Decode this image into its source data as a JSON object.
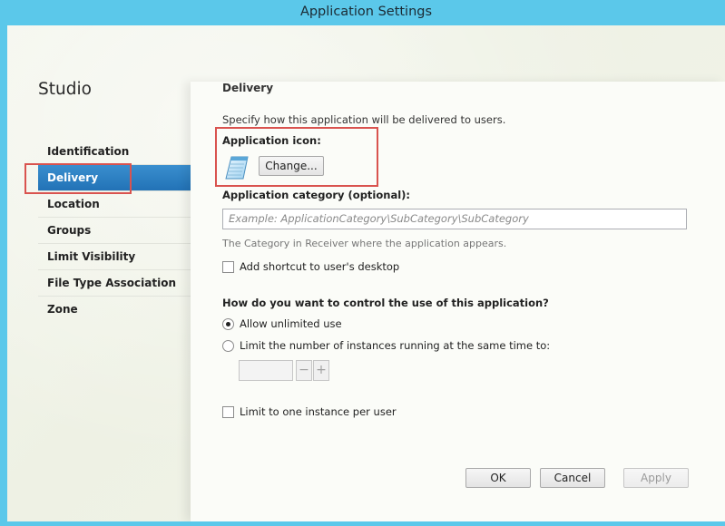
{
  "window": {
    "title": "Application Settings"
  },
  "sidebar": {
    "title": "Studio",
    "items": [
      {
        "label": "Identification",
        "active": false
      },
      {
        "label": "Delivery",
        "active": true
      },
      {
        "label": "Location",
        "active": false
      },
      {
        "label": "Groups",
        "active": false
      },
      {
        "label": "Limit Visibility",
        "active": false
      },
      {
        "label": "File Type Association",
        "active": false
      },
      {
        "label": "Zone",
        "active": false
      }
    ]
  },
  "main": {
    "heading": "Delivery",
    "description": "Specify how this application will be delivered to users.",
    "app_icon_label": "Application icon:",
    "change_button": "Change...",
    "category_label": "Application category (optional):",
    "category_placeholder": "Example: ApplicationCategory\\SubCategory\\SubCategory",
    "category_hint": "The Category in Receiver where the application appears.",
    "shortcut_label": "Add shortcut to user's desktop",
    "shortcut_checked": false,
    "usage_question": "How do you want to control the use of this application?",
    "allow_unlimited_label": "Allow unlimited use",
    "limit_instances_label": "Limit the number of instances running at the same time to:",
    "selected_option": "allow_unlimited",
    "instances_value": "",
    "stepper_minus": "−",
    "stepper_plus": "+",
    "one_instance_label": "Limit to one instance per user",
    "one_instance_checked": false
  },
  "footer": {
    "ok_label": "OK",
    "cancel_label": "Cancel",
    "apply_label": "Apply"
  },
  "colors": {
    "titlebar": "#5bc8ea",
    "active_nav": "#2a7cbf",
    "highlight_annotation": "#d9534f"
  }
}
